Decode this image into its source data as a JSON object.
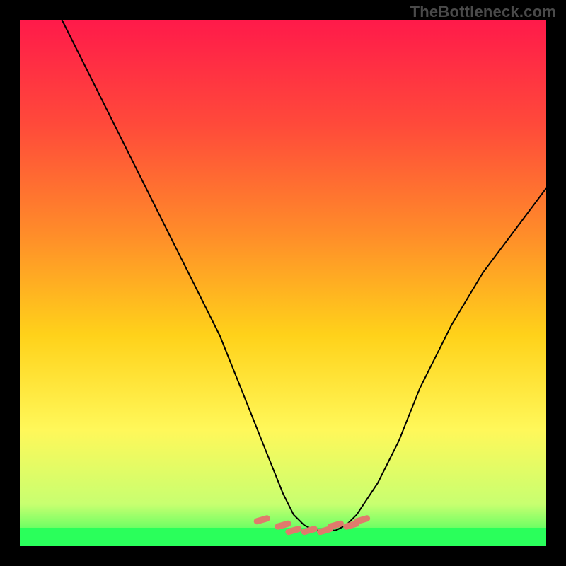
{
  "header": {
    "watermark": "TheBottleneck.com"
  },
  "chart_data": {
    "type": "line",
    "title": "",
    "xlabel": "",
    "ylabel": "",
    "xlim": [
      0,
      100
    ],
    "ylim": [
      0,
      100
    ],
    "grid": false,
    "legend": false,
    "background": "heat-gradient-red-to-green",
    "series": [
      {
        "name": "curve",
        "x": [
          8,
          14,
          20,
          26,
          32,
          38,
          42,
          46,
          50,
          52,
          54,
          56,
          58,
          60,
          62,
          64,
          68,
          72,
          76,
          82,
          88,
          94,
          100
        ],
        "values": [
          100,
          88,
          76,
          64,
          52,
          40,
          30,
          20,
          10,
          6,
          4,
          3,
          3,
          3,
          4,
          6,
          12,
          20,
          30,
          42,
          52,
          60,
          68
        ]
      },
      {
        "name": "highlight-markers",
        "x": [
          46,
          50,
          52,
          55,
          58,
          60,
          63,
          65
        ],
        "values": [
          5,
          4,
          3,
          3,
          3,
          4,
          4,
          5
        ]
      }
    ],
    "gradient_stops": [
      {
        "pos": 0.0,
        "color": "#ff1a4a"
      },
      {
        "pos": 0.2,
        "color": "#ff4a3a"
      },
      {
        "pos": 0.4,
        "color": "#ff8a2a"
      },
      {
        "pos": 0.6,
        "color": "#ffd21a"
      },
      {
        "pos": 0.78,
        "color": "#fff85a"
      },
      {
        "pos": 0.92,
        "color": "#c8ff70"
      },
      {
        "pos": 1.0,
        "color": "#2aff5b"
      }
    ],
    "green_band_top_fraction": 0.965
  }
}
